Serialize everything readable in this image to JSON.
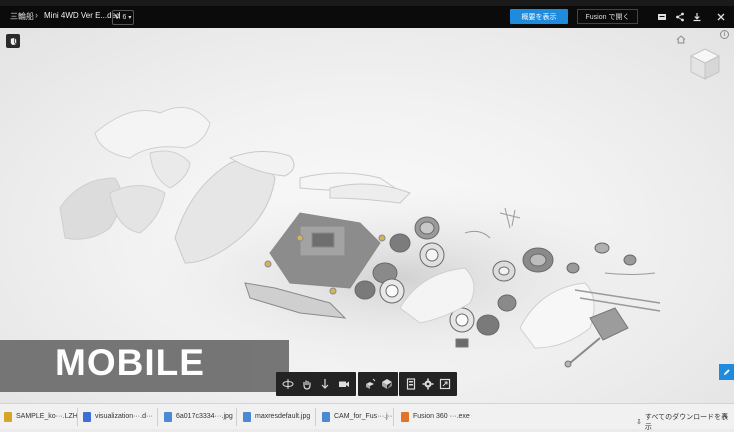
{
  "header": {
    "home_crumb": "三輪船",
    "title": "Mini 4WD Ver E...ded",
    "version": "V. 6",
    "primary_button": "概要を表示",
    "secondary_button": "Fusion で開く"
  },
  "overlay": {
    "label": "MOBILE"
  },
  "navbar": {
    "tools": [
      "orbit-icon",
      "pan-icon",
      "zoom-icon",
      "camera-icon",
      "explode-icon",
      "section-icon",
      "model-browser-icon",
      "settings-icon",
      "fullscreen-icon"
    ]
  },
  "downloads": {
    "items": [
      {
        "name": "SAMPLE_ko···.LZH",
        "color": "#d7a42a"
      },
      {
        "name": "visualization···.d···",
        "color": "#3d6fd6"
      },
      {
        "name": "6a017c3334···.jpg",
        "color": "#4a8ad4"
      },
      {
        "name": "maxresdefault.jpg",
        "color": "#4a8ad4"
      },
      {
        "name": "CAM_for_Fus···.j···",
        "color": "#4a8ad4"
      },
      {
        "name": "Fusion 360 ···.exe",
        "color": "#e2732a"
      }
    ],
    "show_all": "すべてのダウンロードを表示"
  },
  "colors": {
    "accent": "#1f8bdc",
    "topbar": "#0b0b0b"
  }
}
